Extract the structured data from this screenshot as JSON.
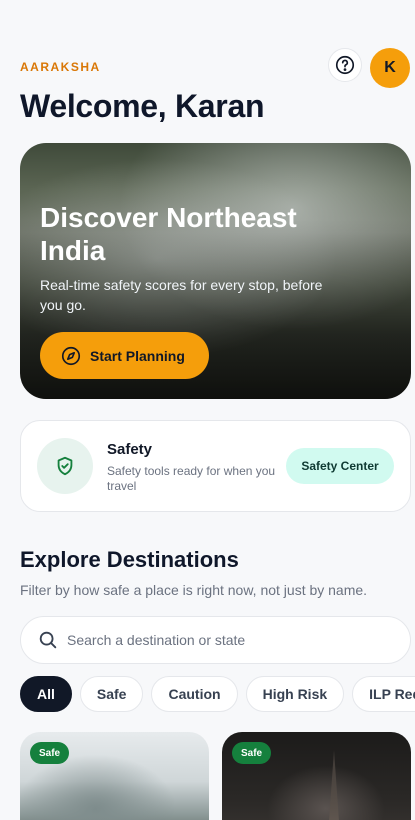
{
  "header": {
    "brand": "AARAKSHA",
    "welcome": "Welcome, Karan",
    "avatar_initial": "K",
    "help_icon": "question-circle-icon"
  },
  "hero": {
    "title": "Discover Northeast India",
    "subtitle": "Real-time safety scores for every stop, before you go.",
    "cta_label": "Start Planning",
    "cta_icon": "compass-icon"
  },
  "safety": {
    "icon": "shield-check-icon",
    "title": "Safety",
    "description": "Safety tools ready for when you travel",
    "button_label": "Safety Center"
  },
  "explore": {
    "title": "Explore Destinations",
    "subtitle": "Filter by how safe a place is right now, not just by name.",
    "search": {
      "placeholder": "Search a destination or state",
      "value": "",
      "icon": "search-icon"
    },
    "filters": [
      {
        "label": "All",
        "active": true
      },
      {
        "label": "Safe",
        "active": false
      },
      {
        "label": "Caution",
        "active": false
      },
      {
        "label": "High Risk",
        "active": false
      },
      {
        "label": "ILP Req",
        "active": false
      }
    ],
    "destinations": [
      {
        "badge": "Safe"
      },
      {
        "badge": "Safe"
      }
    ]
  },
  "colors": {
    "accent": "#f59e0b",
    "brand": "#d97706",
    "safe_badge": "#15803d",
    "safety_button": "#d1faf0",
    "dark": "#111827"
  }
}
